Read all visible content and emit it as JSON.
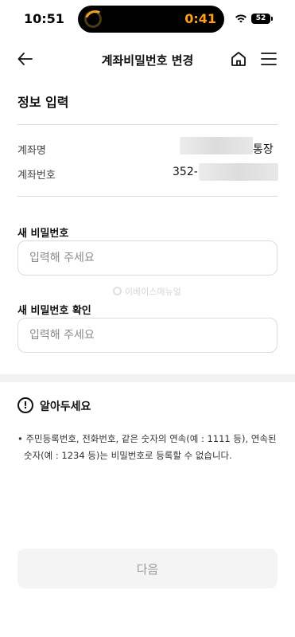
{
  "status_bar": {
    "time": "10:51",
    "timer": "0:41",
    "battery": "52"
  },
  "header": {
    "title": "계좌비밀번호 변경"
  },
  "info": {
    "section_title": "정보 입력",
    "account_name_label": "계좌명",
    "account_name_suffix": "통장",
    "account_number_label": "계좌번호",
    "account_number_prefix": "352-"
  },
  "form": {
    "new_password_label": "새 비밀번호",
    "new_password_placeholder": "입력해 주세요",
    "confirm_password_label": "새 비밀번호 확인",
    "confirm_password_placeholder": "입력해 주세요"
  },
  "watermark": "이베이스매뉴얼",
  "notice": {
    "icon_glyph": "!",
    "title": "알아두세요",
    "text": "• 주민등록번호, 전화번호, 같은 숫자의 연속(예 : 1111 등), 연속된 숫자(예 : 1234 등)는 비밀번호로 등록할 수 없습니다."
  },
  "footer": {
    "next_label": "다음"
  },
  "colors": {
    "timer": "#ff9f1a",
    "disabled_button_bg": "#f4f4f5",
    "disabled_button_text": "#9a9a9a",
    "divider": "#dcdcdc"
  }
}
